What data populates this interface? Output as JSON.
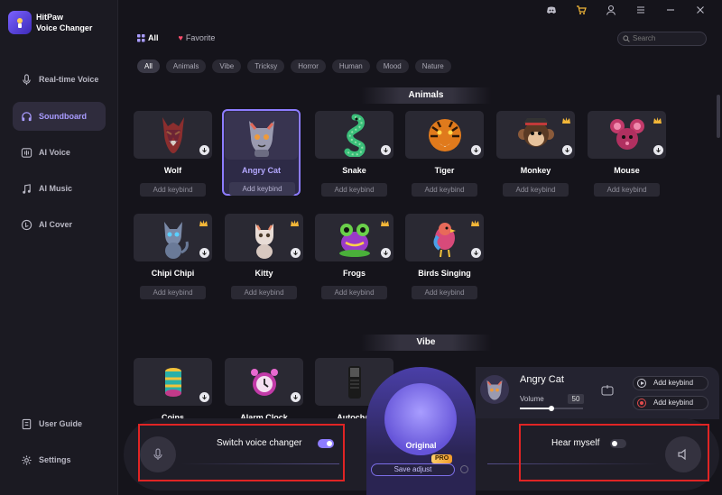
{
  "app": {
    "name_line1": "HitPaw",
    "name_line2": "Voice Changer",
    "accent": "#8d7cff"
  },
  "sidebar": {
    "items": [
      {
        "label": "Real-time Voice",
        "icon": "microphone-icon"
      },
      {
        "label": "Soundboard",
        "icon": "headphones-icon",
        "active": true
      },
      {
        "label": "AI Voice",
        "icon": "ai-voice-icon"
      },
      {
        "label": "AI Music",
        "icon": "music-note-icon"
      },
      {
        "label": "AI Cover",
        "icon": "ai-cover-icon"
      }
    ],
    "bottom": [
      {
        "label": "User Guide",
        "icon": "book-icon"
      },
      {
        "label": "Settings",
        "icon": "gear-icon"
      }
    ]
  },
  "topbar": {
    "icons": [
      "discord-icon",
      "cart-icon",
      "user-icon",
      "menu-icon",
      "close-icon"
    ]
  },
  "tabs": [
    {
      "label": "All",
      "active": true
    },
    {
      "label": "Favorite"
    }
  ],
  "search": {
    "placeholder": "Search"
  },
  "chips": [
    "All",
    "Animals",
    "Vibe",
    "Tricksy",
    "Horror",
    "Human",
    "Mood",
    "Nature"
  ],
  "sections": {
    "animals": "Animals",
    "vibe": "Vibe"
  },
  "cards": [
    {
      "name": "Wolf",
      "keybind": "Add keybind"
    },
    {
      "name": "Angry Cat",
      "keybind": "Add keybind",
      "selected": true
    },
    {
      "name": "Snake",
      "keybind": "Add keybind"
    },
    {
      "name": "Tiger",
      "keybind": "Add keybind"
    },
    {
      "name": "Monkey",
      "keybind": "Add keybind",
      "premium": true
    },
    {
      "name": "Mouse",
      "keybind": "Add keybind",
      "premium": true
    },
    {
      "name": "Chipi Chipi",
      "keybind": "Add keybind",
      "premium": true
    },
    {
      "name": "Kitty",
      "keybind": "Add keybind",
      "premium": true
    },
    {
      "name": "Frogs",
      "keybind": "Add keybind",
      "premium": true
    },
    {
      "name": "Birds Singing",
      "keybind": "Add keybind",
      "premium": true
    },
    {
      "name": "Coins"
    },
    {
      "name": "Alarm Clock"
    },
    {
      "name": "Autochai"
    }
  ],
  "bottom": {
    "switch_label": "Switch voice changer",
    "switch_on": true,
    "orb_label": "Original",
    "pro": "PRO",
    "save_adjust": "Save adjust",
    "hear_label": "Hear myself",
    "hear_on": false
  },
  "voice_panel": {
    "name": "Angry Cat",
    "volume_label": "Volume",
    "volume": "50",
    "volume_fraction": 0.5,
    "keybind_play": "Add keybind",
    "keybind_record": "Add keybind"
  }
}
